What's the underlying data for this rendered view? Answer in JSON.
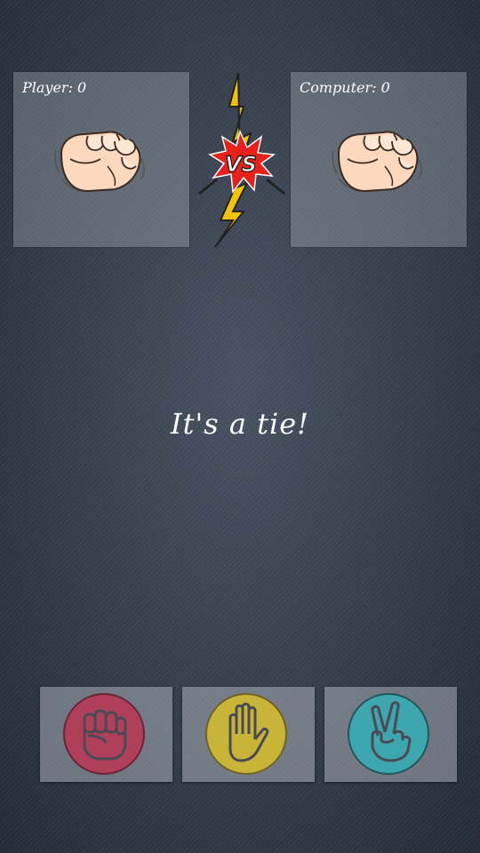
{
  "player": {
    "score_label": "Player: 0",
    "hand": "rock"
  },
  "computer": {
    "score_label": "Computer: 0",
    "hand": "rock"
  },
  "vs_label": "VS",
  "result_text": "It's a tie!",
  "choices": [
    {
      "name": "rock",
      "icon": "fist-icon",
      "color": "#b0405a"
    },
    {
      "name": "paper",
      "icon": "open-hand-icon",
      "color": "#c9b43a"
    },
    {
      "name": "scissors",
      "icon": "peace-hand-icon",
      "color": "#3ea6ae"
    }
  ]
}
